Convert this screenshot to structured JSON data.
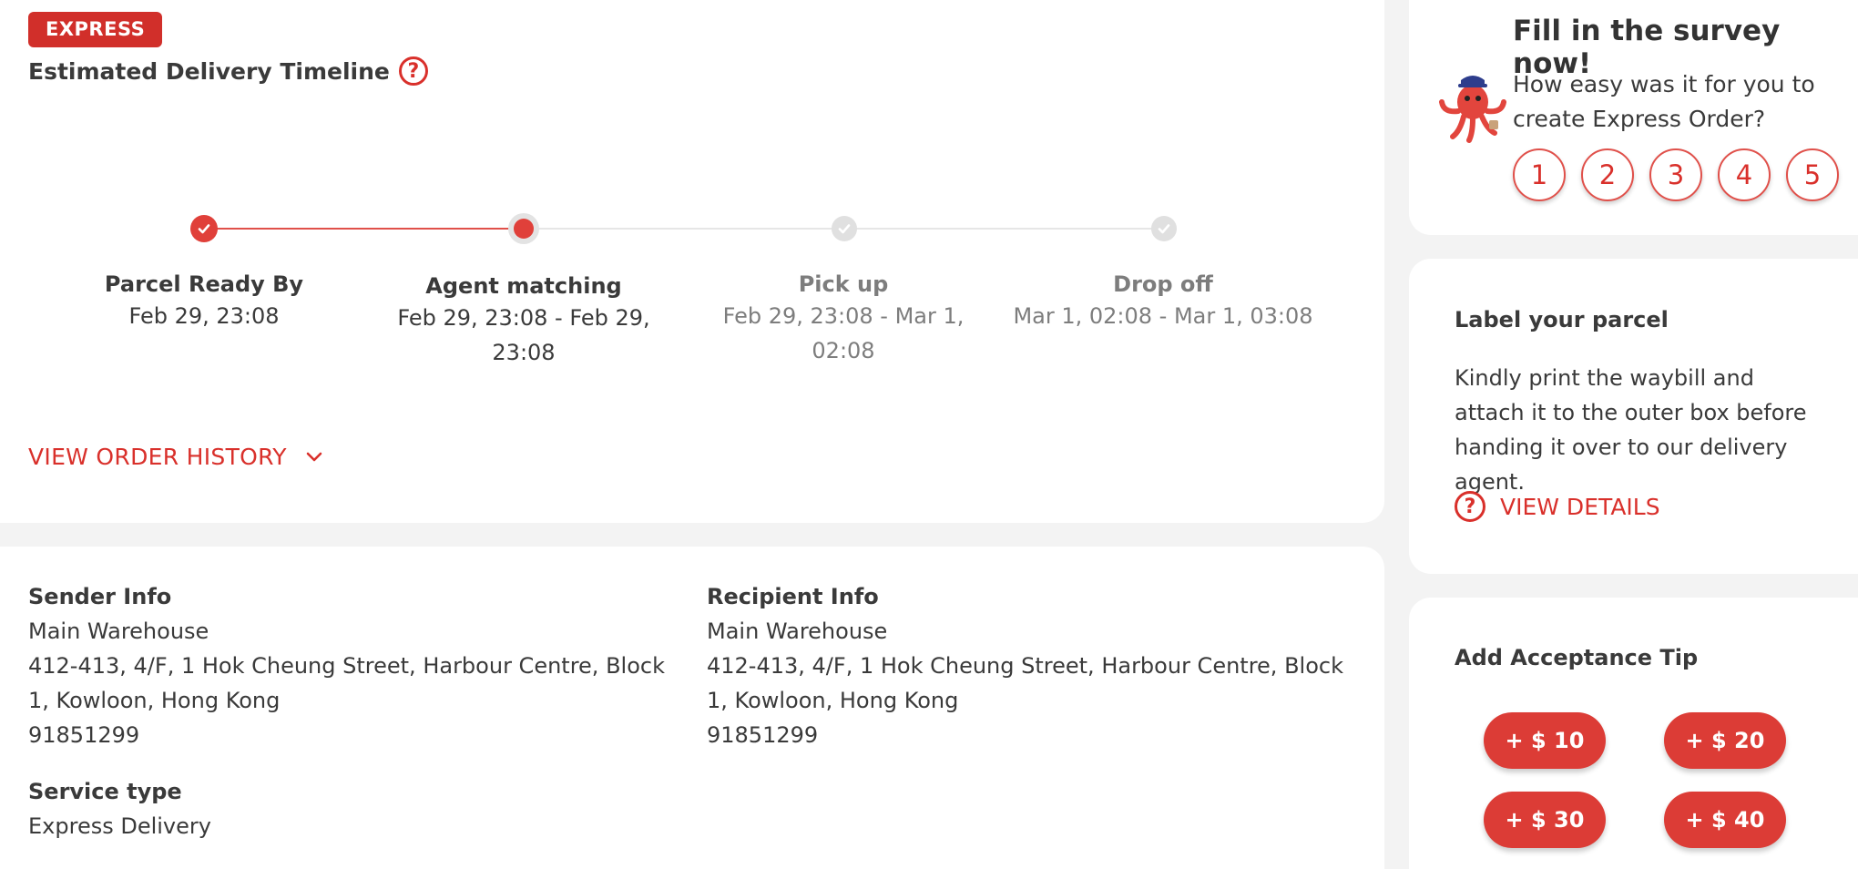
{
  "timeline": {
    "badge": "EXPRESS",
    "title": "Estimated Delivery Timeline",
    "steps": [
      {
        "title": "Parcel Ready By",
        "time": "Feb 29, 23:08",
        "status": "done"
      },
      {
        "title": "Agent matching",
        "time": "Feb 29, 23:08 - Feb 29, 23:08",
        "status": "current"
      },
      {
        "title": "Pick up",
        "time": "Feb 29, 23:08 - Mar 1, 02:08",
        "status": "pending"
      },
      {
        "title": "Drop off",
        "time": "Mar 1, 02:08 - Mar 1, 03:08",
        "status": "pending"
      }
    ],
    "history_label": "VIEW ORDER HISTORY"
  },
  "sender": {
    "heading": "Sender Info",
    "name": "Main Warehouse",
    "address": "412-413, 4/F, 1 Hok Cheung Street, Harbour Centre, Block 1, Kowloon, Hong Kong",
    "phone": "91851299"
  },
  "recipient": {
    "heading": "Recipient Info",
    "name": "Main Warehouse",
    "address": "412-413, 4/F, 1 Hok Cheung Street, Harbour Centre, Block 1, Kowloon, Hong Kong",
    "phone": "91851299"
  },
  "service": {
    "heading": "Service type",
    "value": "Express Delivery"
  },
  "survey": {
    "title": "Fill in the survey now!",
    "question": "How easy was it for you to create Express Order?",
    "ratings": [
      "1",
      "2",
      "3",
      "4",
      "5"
    ]
  },
  "label_card": {
    "title": "Label your parcel",
    "body": "Kindly print the waybill and attach it to the outer box before handing it over to our delivery agent.",
    "link": "VIEW DETAILS"
  },
  "tip": {
    "title": "Add Acceptance Tip",
    "options": [
      "+ $ 10",
      "+ $ 20",
      "+ $ 30",
      "+ $ 40"
    ]
  },
  "colors": {
    "accent": "#d9302b",
    "pending_gray": "#e0e0e0"
  }
}
